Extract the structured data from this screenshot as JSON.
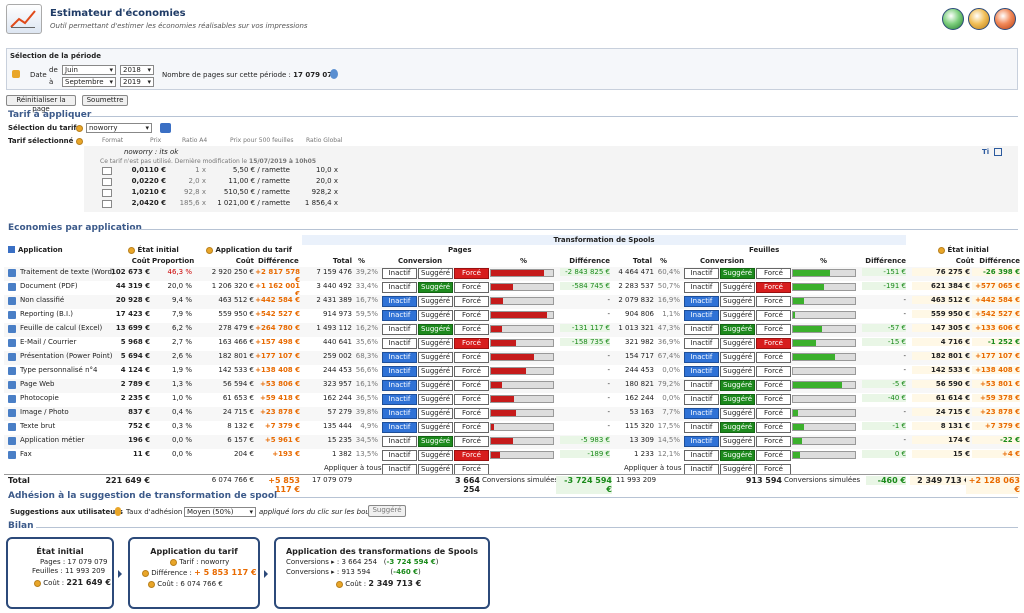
{
  "header": {
    "title": "Estimateur d'économies",
    "subtitle": "Outil permettant d'estimer les économies réalisables sur vos impressions"
  },
  "period": {
    "section_title": "Sélection de la période",
    "date_label": "Date",
    "from_label": "de",
    "to_label": "à",
    "from_month": "Juin",
    "from_year": "2018",
    "to_month": "Septembre",
    "to_year": "2019",
    "pages_label": "Nombre de pages sur cette période :",
    "pages_value": "17 079 079"
  },
  "actions": {
    "reset": "Réinitialiser la page",
    "submit": "Soumettre"
  },
  "tariff": {
    "section_title": "Tarif à appliquer",
    "select_label": "Sélection du tarif",
    "selected": "noworry",
    "selected_label": "Tarif sélectionné",
    "cols": [
      "Format",
      "Prix",
      "Ratio A4",
      "Prix pour 500 feuilles",
      "Ratio Global"
    ],
    "name": "noworry : its ok",
    "note": "Ce tarif n'est pas utilisé. Dernière modification le",
    "note_date": "15/07/2019 à 10h05",
    "rows": [
      {
        "price": "0,0110 €",
        "ratio": "1 x",
        "p500": "5,50 € / ramette",
        "global": "10,0 x"
      },
      {
        "price": "0,0220 €",
        "ratio": "2,0 x",
        "p500": "11,00 € / ramette",
        "global": "20,0 x"
      },
      {
        "price": "1,0210 €",
        "ratio": "92,8 x",
        "p500": "510,50 € / ramette",
        "global": "928,2 x"
      },
      {
        "price": "2,0420 €",
        "ratio": "185,6 x",
        "p500": "1 021,00 € / ramette",
        "global": "1 856,4 x"
      }
    ]
  },
  "economies": {
    "section_title": "Economies par application",
    "spool_title": "Transformation de Spools",
    "h": {
      "application": "Application",
      "etat_initial": "État initial",
      "cout": "Coût",
      "proportion": "Proportion",
      "app_tarif": "Application du tarif",
      "difference": "Différence",
      "pages": "Pages",
      "feuilles": "Feuilles",
      "total": "Total",
      "pct": "%",
      "conversion": "Conversion",
      "etat_final": "État final"
    },
    "toggle": {
      "i": "Inactif",
      "s": "Suggéré",
      "f": "Forcé"
    },
    "rows": [
      {
        "name": "Traitement de texte (Word)",
        "cout": "102 673 €",
        "prop": "46,3 %",
        "tarif": "2 920 250 €",
        "tdiff": "+2 817 578 €",
        "ptot": "7 159 476",
        "ppct": "39,2%",
        "pm": "f",
        "pbar": 0.85,
        "pdiff": "-2 843 825 €",
        "ftot": "4 464 471",
        "fpct": "60,4%",
        "fm": "s",
        "fbar": 0.6,
        "fdiff": "-151 €",
        "fcout": "76 275 €",
        "fdiff2": "-26 398 €"
      },
      {
        "name": "Document (PDF)",
        "cout": "44 319 €",
        "prop": "20,0 %",
        "tarif": "1 206 320 €",
        "tdiff": "+1 162 001 €",
        "ptot": "3 440 492",
        "ppct": "33,4%",
        "pm": "s",
        "pbar": 0.35,
        "pdiff": "-584 745 €",
        "ftot": "2 283 537",
        "fpct": "50,7%",
        "fm": "f",
        "fbar": 0.5,
        "fdiff": "-191 €",
        "fcout": "621 384 €",
        "fdiff2": "+577 065 €"
      },
      {
        "name": "Non classifié",
        "cout": "20 928 €",
        "prop": "9,4 %",
        "tarif": "463 512 €",
        "tdiff": "+442 584 €",
        "ptot": "2 431 389",
        "ppct": "16,7%",
        "pm": "i",
        "pbar": 0.2,
        "pdiff": "-",
        "ftot": "2 079 832",
        "fpct": "16,9%",
        "fm": "i",
        "fbar": 0.17,
        "fdiff": "-",
        "fcout": "463 512 €",
        "fdiff2": "+442 584 €"
      },
      {
        "name": "Reporting (B.I.)",
        "cout": "17 423 €",
        "prop": "7,9 %",
        "tarif": "559 950 €",
        "tdiff": "+542 527 €",
        "ptot": "914 973",
        "ppct": "59,5%",
        "pm": "i",
        "pbar": 0.9,
        "pdiff": "-",
        "ftot": "904 806",
        "fpct": "1,1%",
        "fm": "i",
        "fbar": 0.03,
        "fdiff": "-",
        "fcout": "559 950 €",
        "fdiff2": "+542 527 €"
      },
      {
        "name": "Feuille de calcul (Excel)",
        "cout": "13 699 €",
        "prop": "6,2 %",
        "tarif": "278 479 €",
        "tdiff": "+264 780 €",
        "ptot": "1 493 112",
        "ppct": "16,2%",
        "pm": "s",
        "pbar": 0.18,
        "pdiff": "-131 117 €",
        "ftot": "1 013 321",
        "fpct": "47,3%",
        "fm": "s",
        "fbar": 0.47,
        "fdiff": "-57 €",
        "fcout": "147 305 €",
        "fdiff2": "+133 606 €"
      },
      {
        "name": "E-Mail / Courrier",
        "cout": "5 968 €",
        "prop": "2,7 %",
        "tarif": "163 466 €",
        "tdiff": "+157 498 €",
        "ptot": "440 641",
        "ppct": "35,6%",
        "pm": "f",
        "pbar": 0.4,
        "pdiff": "-158 735 €",
        "ftot": "321 982",
        "fpct": "36,9%",
        "fm": "f",
        "fbar": 0.37,
        "fdiff": "-15 €",
        "fcout": "4 716 €",
        "fdiff2": "-1 252 €"
      },
      {
        "name": "Présentation (Power Point)",
        "cout": "5 694 €",
        "prop": "2,6 %",
        "tarif": "182 801 €",
        "tdiff": "+177 107 €",
        "ptot": "259 002",
        "ppct": "68,3%",
        "pm": "i",
        "pbar": 0.7,
        "pdiff": "-",
        "ftot": "154 717",
        "fpct": "67,4%",
        "fm": "i",
        "fbar": 0.67,
        "fdiff": "-",
        "fcout": "182 801 €",
        "fdiff2": "+177 107 €"
      },
      {
        "name": "Type personnalisé n°4",
        "cout": "4 124 €",
        "prop": "1,9 %",
        "tarif": "142 533 €",
        "tdiff": "+138 408 €",
        "ptot": "244 453",
        "ppct": "56,6%",
        "pm": "i",
        "pbar": 0.57,
        "pdiff": "-",
        "ftot": "244 453",
        "fpct": "0,0%",
        "fm": "i",
        "fbar": 0,
        "fdiff": "-",
        "fcout": "142 533 €",
        "fdiff2": "+138 408 €"
      },
      {
        "name": "Page Web",
        "cout": "2 789 €",
        "prop": "1,3 %",
        "tarif": "56 594 €",
        "tdiff": "+53 806 €",
        "ptot": "323 957",
        "ppct": "16,1%",
        "pm": "i",
        "pbar": 0.18,
        "pdiff": "-",
        "ftot": "180 821",
        "fpct": "79,2%",
        "fm": "s",
        "fbar": 0.79,
        "fdiff": "-5 €",
        "fcout": "56 590 €",
        "fdiff2": "+53 801 €"
      },
      {
        "name": "Photocopie",
        "cout": "2 235 €",
        "prop": "1,0 %",
        "tarif": "61 653 €",
        "tdiff": "+59 418 €",
        "ptot": "162 244",
        "ppct": "36,5%",
        "pm": "i",
        "pbar": 0.37,
        "pdiff": "-",
        "ftot": "162 244",
        "fpct": "0,0%",
        "fm": "s",
        "fbar": 0,
        "fdiff": "-40 €",
        "fcout": "61 614 €",
        "fdiff2": "+59 378 €"
      },
      {
        "name": "Image / Photo",
        "cout": "837 €",
        "prop": "0,4 %",
        "tarif": "24 715 €",
        "tdiff": "+23 878 €",
        "ptot": "57 279",
        "ppct": "39,8%",
        "pm": "i",
        "pbar": 0.4,
        "pdiff": "-",
        "ftot": "53 163",
        "fpct": "7,7%",
        "fm": "i",
        "fbar": 0.08,
        "fdiff": "-",
        "fcout": "24 715 €",
        "fdiff2": "+23 878 €"
      },
      {
        "name": "Texte brut",
        "cout": "752 €",
        "prop": "0,3 %",
        "tarif": "8 132 €",
        "tdiff": "+7 379 €",
        "ptot": "135 444",
        "ppct": "4,9%",
        "pm": "i",
        "pbar": 0.05,
        "pdiff": "-",
        "ftot": "115 320",
        "fpct": "17,5%",
        "fm": "s",
        "fbar": 0.18,
        "fdiff": "-1 €",
        "fcout": "8 131 €",
        "fdiff2": "+7 379 €"
      },
      {
        "name": "Application métier",
        "cout": "196 €",
        "prop": "0,0 %",
        "tarif": "6 157 €",
        "tdiff": "+5 961 €",
        "ptot": "15 235",
        "ppct": "34,5%",
        "pm": "s",
        "pbar": 0.35,
        "pdiff": "-5 983 €",
        "ftot": "13 309",
        "fpct": "14,5%",
        "fm": "i",
        "fbar": 0.15,
        "fdiff": "-",
        "fcout": "174 €",
        "fdiff2": "-22 €"
      },
      {
        "name": "Fax",
        "cout": "11 €",
        "prop": "0,0 %",
        "tarif": "204 €",
        "tdiff": "+193 €",
        "ptot": "1 382",
        "ppct": "13,5%",
        "pm": "f",
        "pbar": 0.14,
        "pdiff": "-189 €",
        "ftot": "1 233",
        "fpct": "12,1%",
        "fm": "s",
        "fbar": 0.12,
        "fdiff": "0 €",
        "fcout": "15 €",
        "fdiff2": "+4 €"
      }
    ],
    "apply_all": "Appliquer à tous :",
    "total": {
      "label": "Total",
      "cout": "221 649 €",
      "tarif": "6 074 766 €",
      "tdiff": "+5 853 117 €",
      "ptot": "17 079 079",
      "pconv": "3 664 254",
      "conv_label": "Conversions simulées",
      "pdiff": "-3 724 594 €",
      "ftot": "11 993 209",
      "fconv": "913 594",
      "fdiff": "-460 €",
      "fcout": "2 349 713 €",
      "fdiff2": "+2 128 063 €"
    }
  },
  "adhesion": {
    "section_title": "Adhésion à la suggestion de transformation de spool",
    "label": "Suggestions aux utilisateurs",
    "rate_label": "Taux d'adhésion :",
    "rate": "Moyen (50%)",
    "note": "appliqué lors du clic sur les boutons",
    "btn": "Suggéré"
  },
  "bilan": {
    "section_title": "Bilan",
    "c1": {
      "title": "État initial",
      "pages": "Pages : 17 079 079",
      "feuilles": "Feuilles : 11 993 209",
      "cout_label": "Coût :",
      "cout": "221 649 €"
    },
    "c2": {
      "title": "Application du tarif",
      "tarif": "Tarif : noworry",
      "diff_label": "Différence :",
      "diff": "+ 5 853 117 €",
      "cout": "Coût : 6 074 766 €"
    },
    "c3": {
      "title": "Application des transformations de Spools",
      "conv": "Conversions",
      "conv1_val": ": 3 664 254",
      "conv1_diff": "-3 724 594 €",
      "conv2_val": ": 913 594",
      "conv2_diff": "-460 €",
      "cout_label": "Coût :",
      "cout": "2 349 713 €"
    }
  }
}
